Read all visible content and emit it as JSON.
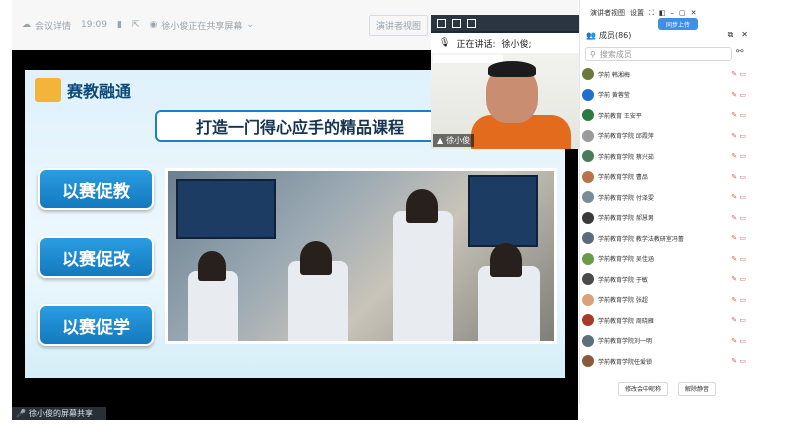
{
  "top_bar": {
    "meeting_details": "会议详情",
    "time": "19:09",
    "sharing_status": "徐小俊正在共享屏幕",
    "presenter_view": "演讲者视图"
  },
  "slide": {
    "logo_text": "赛教融通",
    "title": "打造一门得心应手的精品课程",
    "pills": [
      "以赛促教",
      "以赛促改",
      "以赛促学"
    ]
  },
  "share_label": "徐小俊的屏幕共享",
  "speaker": {
    "speaking_now": "正在讲话:",
    "speaking_name": "徐小俊;",
    "name_tag": "徐小俊"
  },
  "panel": {
    "top_items": [
      "演讲者视图",
      "设置",
      "同步上传"
    ],
    "sync_label": "同步上传",
    "members_title": "成员(86)",
    "search_placeholder": "搜索成员",
    "members": [
      {
        "name": "学前 韩湘梅",
        "color": "#6b7a3a"
      },
      {
        "name": "学前 黄蓉莹",
        "color": "#1f6fd1"
      },
      {
        "name": "学前教育 王安平",
        "color": "#2d7a42"
      },
      {
        "name": "学前教育学院 邱霞萍",
        "color": "#9b9b9b"
      },
      {
        "name": "学前教育学院 蔡兴茹",
        "color": "#4a7c59"
      },
      {
        "name": "学前教育学院 曹品",
        "color": "#b8734a"
      },
      {
        "name": "学前教育学院 付泽雯",
        "color": "#7a8c99"
      },
      {
        "name": "学前教育学院 郝慧男",
        "color": "#3a3a3a"
      },
      {
        "name": "学前教育学院 教学法教研室冯蕾",
        "color": "#5a6b7c"
      },
      {
        "name": "学前教育学院 吴佳涵",
        "color": "#6c9a4a"
      },
      {
        "name": "学前教育学院 于敏",
        "color": "#4a4a4a"
      },
      {
        "name": "学前教育学院 张超",
        "color": "#d9a27a"
      },
      {
        "name": "学前教育学院 周晓雁",
        "color": "#a83a2a"
      },
      {
        "name": "学前教育学院刘一明",
        "color": "#5c6f7a"
      },
      {
        "name": "学前教育学院任爱锁",
        "color": "#8a5a3a"
      }
    ],
    "footer_buttons": [
      "修改会中昵称",
      "解除静音"
    ]
  }
}
